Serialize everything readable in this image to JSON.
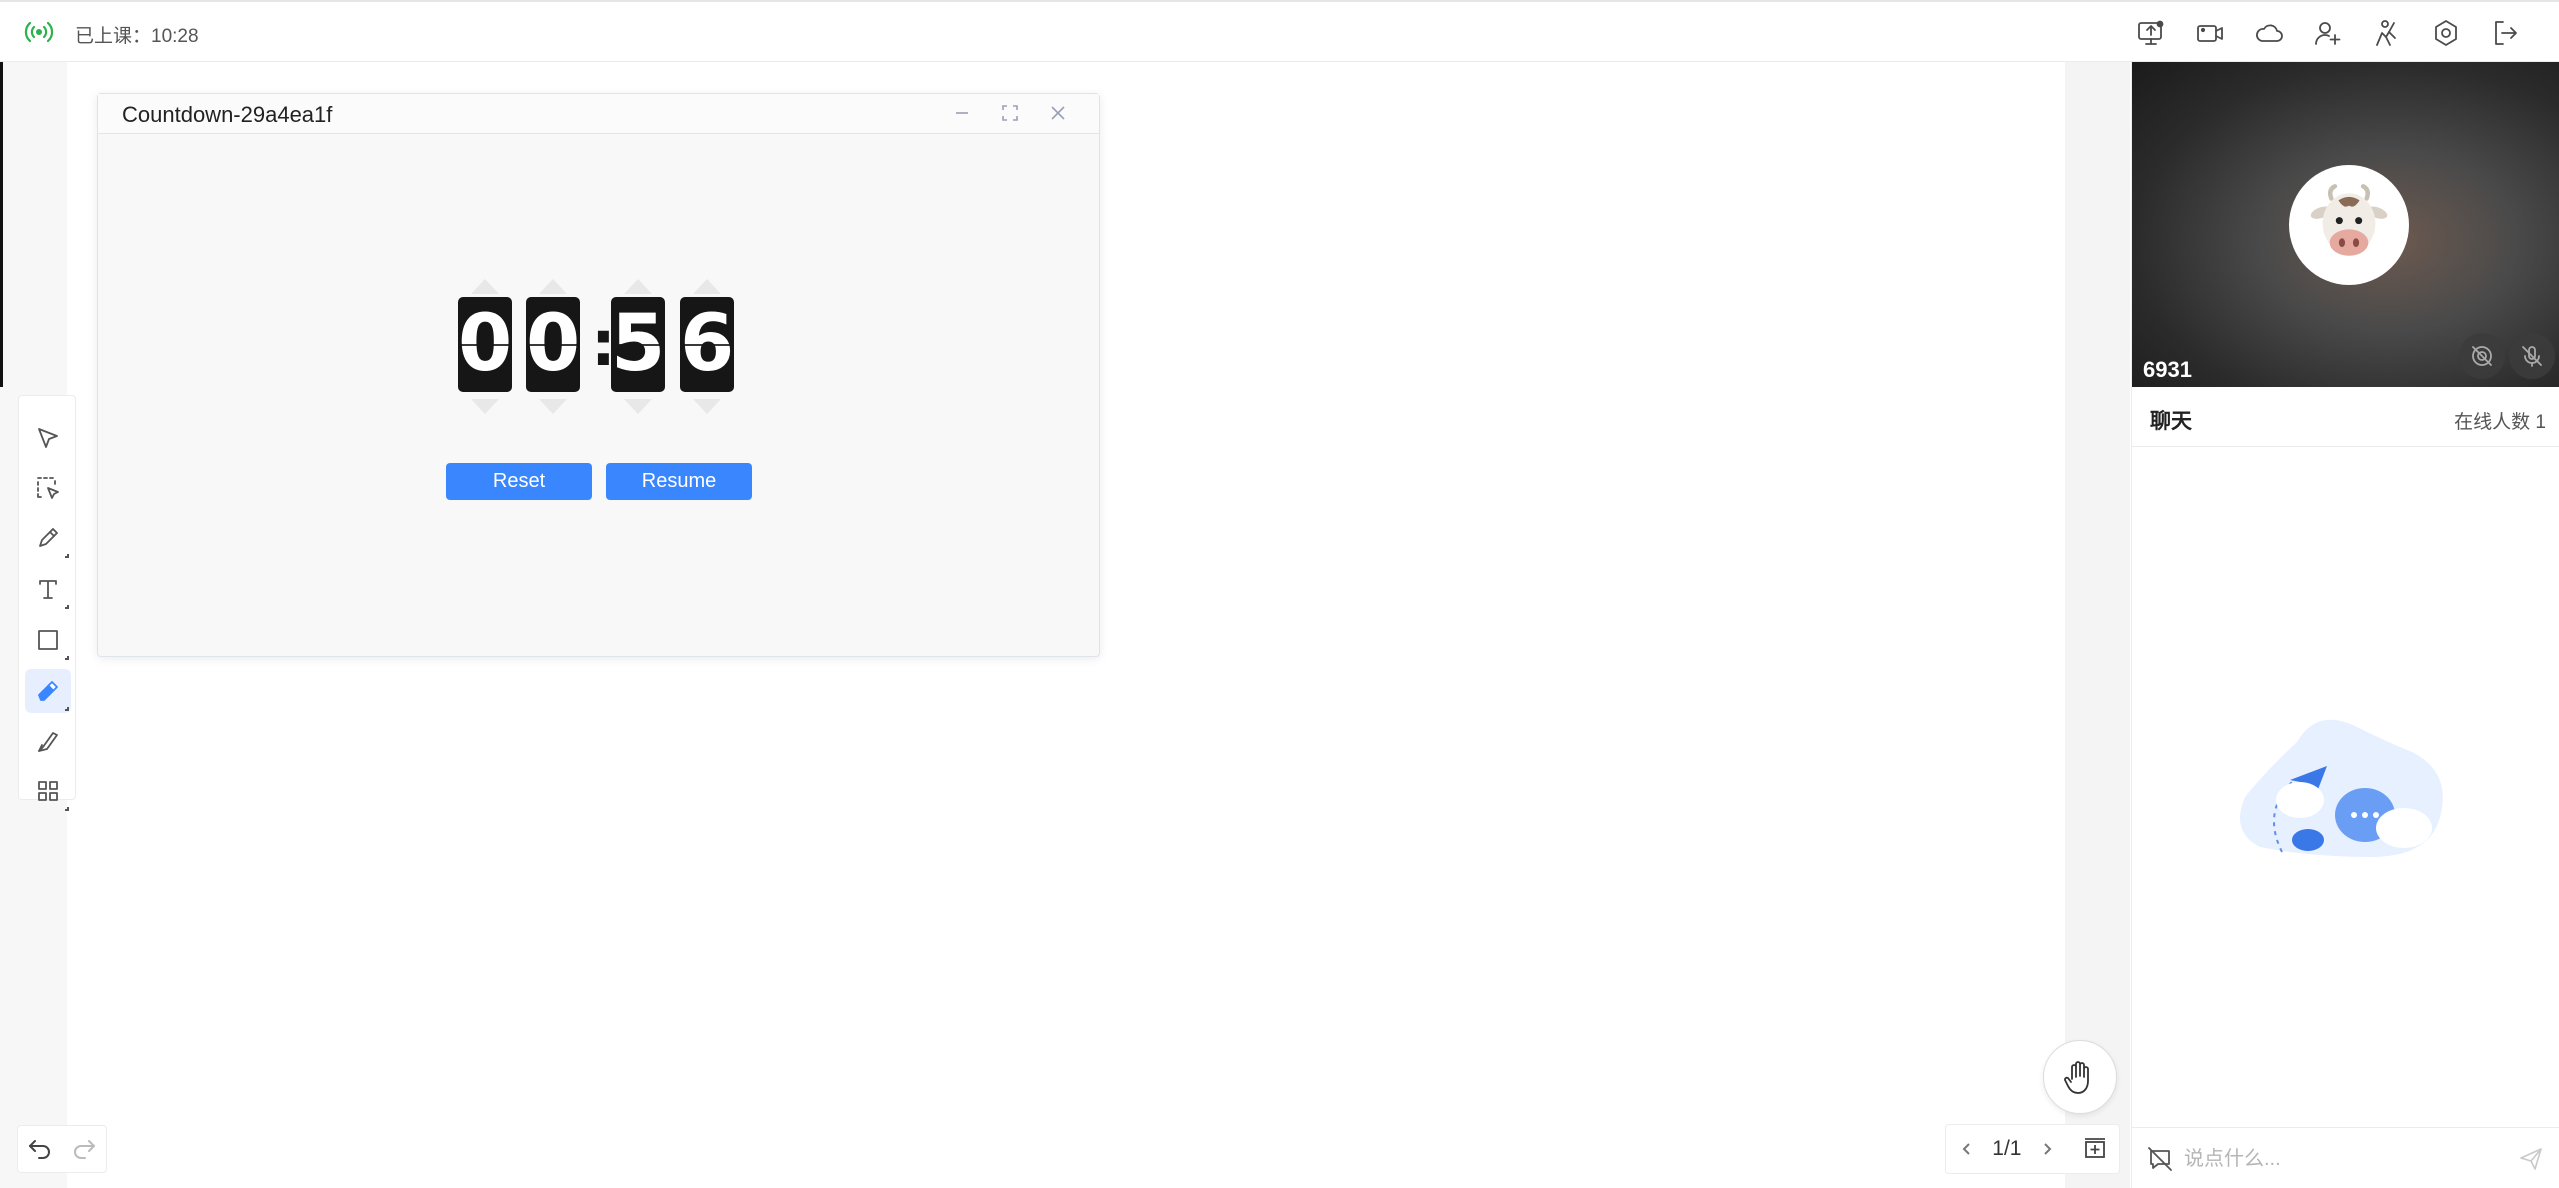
{
  "status": {
    "class_time": "已上课：10:28"
  },
  "top_icons": [
    "screen-share-icon",
    "camera-icon",
    "cloud-icon",
    "add-user-icon",
    "hands-up-icon",
    "settings-icon",
    "exit-icon"
  ],
  "countdown": {
    "title": "Countdown-29a4ea1f",
    "digits": [
      "0",
      "0",
      "5",
      "6"
    ],
    "colon": ":",
    "reset_label": "Reset",
    "resume_label": "Resume"
  },
  "tools": [
    "select-icon",
    "area-select-icon",
    "pencil-icon",
    "text-icon",
    "rectangle-icon",
    "eraser-icon",
    "laser-pointer-icon",
    "apps-grid-icon"
  ],
  "active_tool": "eraser-icon",
  "pager": {
    "page": "1/1"
  },
  "video": {
    "user_id": "6931"
  },
  "chat": {
    "title": "聊天",
    "online": "在线人数 1",
    "placeholder": "说点什么..."
  },
  "colors": {
    "accent": "#3a86ff",
    "signal": "#2bb24c"
  }
}
